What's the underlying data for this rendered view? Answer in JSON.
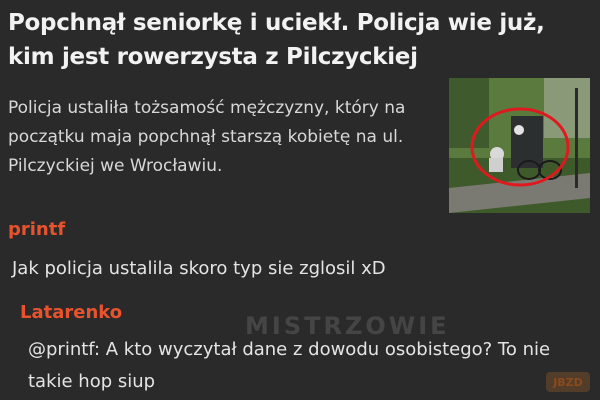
{
  "article": {
    "headline": "Popchnął seniorkę i uciekł. Policja wie już, kim jest rowerzysta z Pilczyckiej",
    "summary": "Policja ustaliła tożsamość mężczyzny, który na początku maja popchnął starszą kobietę na ul. Pilczyckiej we Wrocławiu."
  },
  "comments": [
    {
      "author": "printf",
      "text": "Jak policja ustalila skoro typ sie zglosil xD"
    },
    {
      "author": "Latarenko",
      "text": "@printf: A kto wyczytał dane z dowodu osobistego? To nie takie hop siup"
    }
  ],
  "watermark": {
    "text": "MISTRZOWIE",
    "logo": "JBZD"
  },
  "colors": {
    "background": "#2a2a2a",
    "author": "#e8532d",
    "highlight_circle": "#e0191f"
  }
}
